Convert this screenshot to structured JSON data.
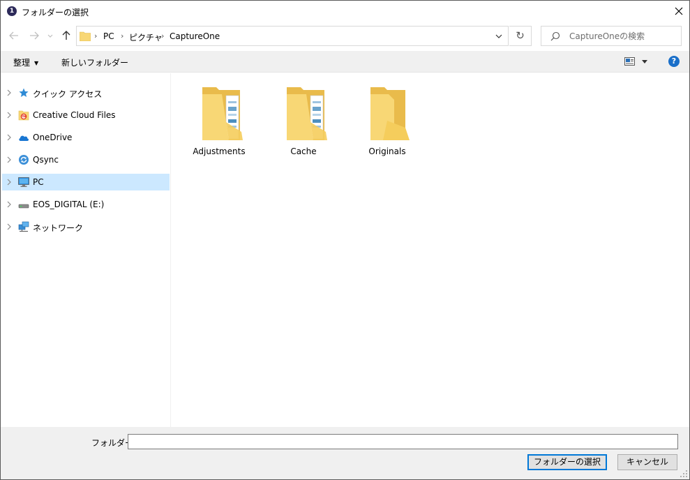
{
  "window": {
    "title": "フォルダーの選択",
    "app_icon_glyph": "1"
  },
  "address": {
    "crumbs": [
      "PC",
      "ピクチャ",
      "CaptureOne"
    ],
    "separator": "›"
  },
  "search": {
    "placeholder": "CaptureOneの検索",
    "value": ""
  },
  "commandbar": {
    "organize": "整理",
    "new_folder": "新しいフォルダー",
    "help": "?"
  },
  "navigation": {
    "items": [
      {
        "label": "クイック アクセス",
        "icon": "star-icon",
        "selected": false
      },
      {
        "label": "Creative Cloud Files",
        "icon": "creative-cloud-icon",
        "selected": false
      },
      {
        "label": "OneDrive",
        "icon": "cloud-icon",
        "selected": false
      },
      {
        "label": "Qsync",
        "icon": "sync-icon",
        "selected": false
      },
      {
        "label": "PC",
        "icon": "computer-icon",
        "selected": true
      },
      {
        "label": "EOS_DIGITAL (E:)",
        "icon": "drive-icon",
        "selected": false
      },
      {
        "label": "ネットワーク",
        "icon": "network-icon",
        "selected": false
      }
    ]
  },
  "content": {
    "folders": [
      {
        "name": "Adjustments",
        "has_contents": true
      },
      {
        "name": "Cache",
        "has_contents": true
      },
      {
        "name": "Originals",
        "has_contents": false
      }
    ]
  },
  "footer": {
    "folder_label": "フォルダー:",
    "folder_value": "",
    "select_button": "フォルダーの選択",
    "cancel_button": "キャンセル"
  },
  "colors": {
    "selection": "#cce8ff",
    "folder_yellow": "#f8d775",
    "accent": "#0078d7",
    "help_blue": "#1a6fc9"
  }
}
